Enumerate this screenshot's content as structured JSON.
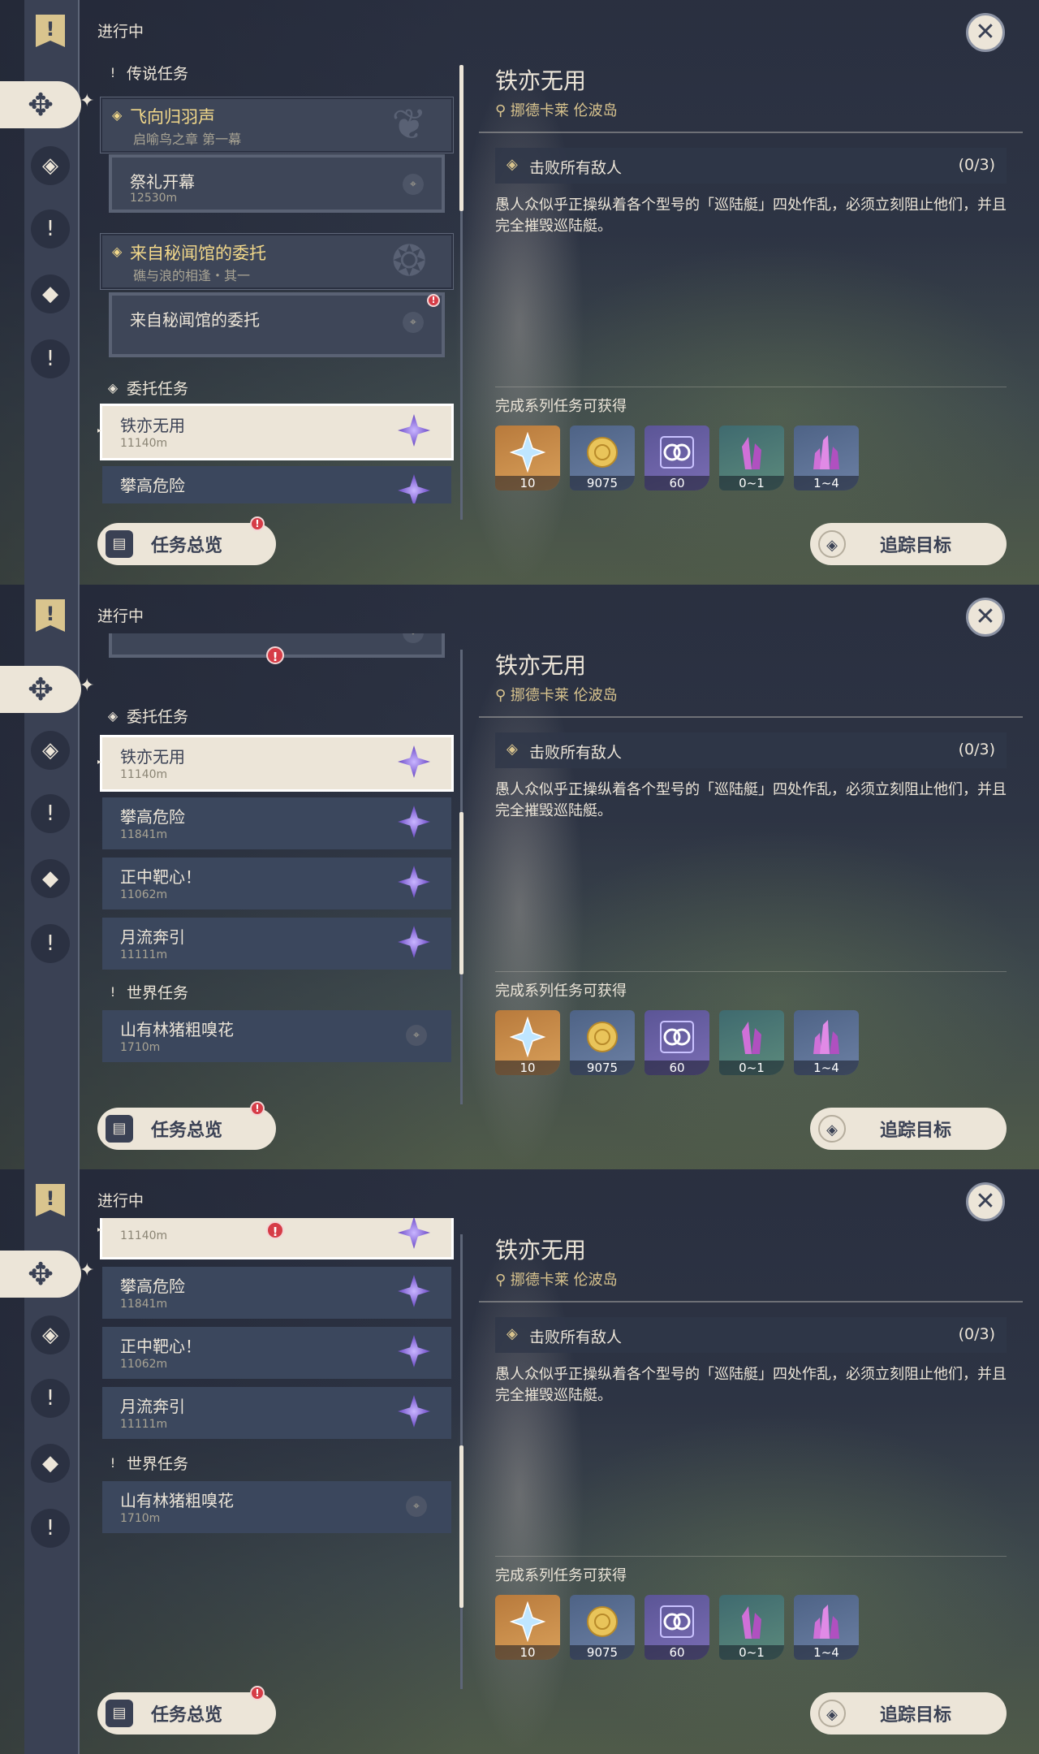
{
  "header": {
    "status_title": "进行中"
  },
  "detail": {
    "title": "铁亦无用",
    "location": "挪德卡莱 伦波岛",
    "objective": "击败所有敌人",
    "objective_count": "(0/3)",
    "description": "愚人众似乎正操纵着各个型号的「巡陆艇」四处作乱，必须立刻阻止他们，并且完全摧毁巡陆艇。",
    "rewards_label": "完成系列任务可获得",
    "rewards": [
      {
        "icon": "primogem-icon",
        "count": "10"
      },
      {
        "icon": "mora-icon",
        "count": "9075"
      },
      {
        "icon": "friendship-icon",
        "count": "60"
      },
      {
        "icon": "crystal-icon",
        "count": "0~1"
      },
      {
        "icon": "crystal-cluster-icon",
        "count": "1~4"
      }
    ]
  },
  "buttons": {
    "overview": "任务总览",
    "track": "追踪目标"
  },
  "sections": {
    "legend": "传说任务",
    "commission": "委托任务",
    "world": "世界任务"
  },
  "legend_quests": [
    {
      "chapter": "飞向归羽声",
      "sub": "启喻鸟之章 第一幕",
      "quest": "祭礼开幕",
      "dist": "12530m"
    },
    {
      "chapter": "来自秘闻馆的委托",
      "sub": "礁与浪的相逢・其一",
      "quest": "来自秘闻馆的委托",
      "dist": ""
    }
  ],
  "commissions": [
    {
      "name": "铁亦无用",
      "dist": "11140m"
    },
    {
      "name": "攀高危险",
      "dist": "11841m"
    },
    {
      "name": "正中靶心！",
      "dist": "11062m"
    },
    {
      "name": "月流奔引",
      "dist": "11111m"
    }
  ],
  "world_quests": [
    {
      "name": "山有林猪粗嗅花",
      "dist": "1710m"
    }
  ],
  "alert_glyph": "!",
  "close_glyph": "✕",
  "colors": {
    "accent": "#ece5d8",
    "gold": "#d9c48e",
    "panel": "#3b475d",
    "alert": "#d63c47"
  }
}
